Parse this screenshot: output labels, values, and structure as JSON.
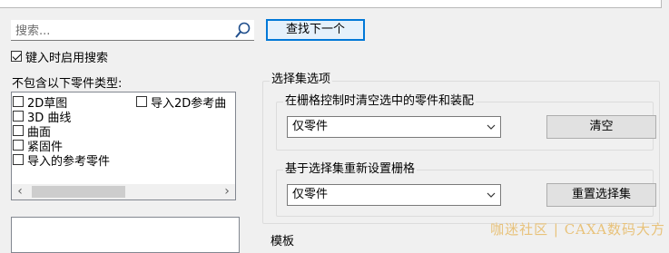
{
  "search": {
    "placeholder": "搜索...",
    "find_next_label": "查找下一个"
  },
  "enable_search": {
    "label": "键入时启用搜索",
    "checked": true
  },
  "exclude": {
    "title": "不包含以下零件类型:",
    "items": [
      {
        "label": "2D草图",
        "checked": false
      },
      {
        "label": "3D 曲线",
        "checked": false
      },
      {
        "label": "曲面",
        "checked": false
      },
      {
        "label": "紧固件",
        "checked": false
      },
      {
        "label": "导入的参考零件",
        "checked": false
      },
      {
        "label": "导入2D参考曲",
        "checked": false
      }
    ]
  },
  "selection_set": {
    "title": "选择集选项",
    "clear_group": {
      "title": "在栅格控制时清空选中的零件和装配",
      "combo_value": "仅零件",
      "button_label": "清空"
    },
    "reset_group": {
      "title": "基于选择集重新设置栅格",
      "combo_value": "仅零件",
      "button_label": "重置选择集"
    }
  },
  "template": {
    "title": "模板"
  },
  "watermark": "咖迷社区 | CAXA数码大方"
}
